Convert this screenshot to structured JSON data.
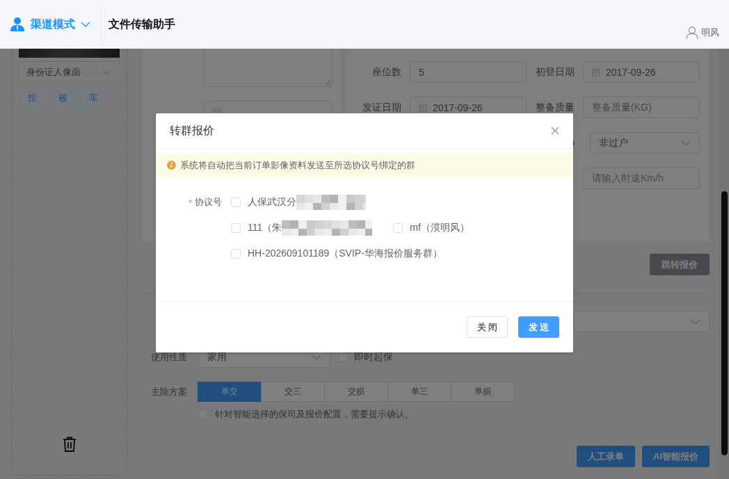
{
  "header": {
    "mode": "渠道模式",
    "title": "文件传输助手",
    "user": "明风"
  },
  "sidebar": {
    "document_type": "身份证人像面",
    "tags": [
      "投",
      "被",
      "车"
    ]
  },
  "vehicle_card": {
    "rows": [
      [
        {
          "label": "座位数",
          "value": "5",
          "kind": "text"
        },
        {
          "label": "初登日期",
          "value": "2017-09-26",
          "kind": "date"
        }
      ],
      [
        {
          "label": "发证日期",
          "value": "2017-09-26",
          "kind": "date"
        },
        {
          "label": "整备质量",
          "placeholder": "整备质量(KG)",
          "kind": "text"
        }
      ],
      [
        {
          "value": "非过户",
          "kind": "select",
          "hint": true
        }
      ],
      [
        {
          "placeholder": "请输入时速Km/h",
          "kind": "text"
        }
      ]
    ]
  },
  "jump_button": "跳转报价",
  "insurance": {
    "usage": {
      "label": "使用性质",
      "value": "家用"
    },
    "instant_start": {
      "label": "即时起保",
      "checked": false
    },
    "plan": {
      "label": "主险方案",
      "options": [
        {
          "label": "单交",
          "selected": true
        },
        {
          "label": "交三",
          "selected": false
        },
        {
          "label": "交损",
          "selected": false
        },
        {
          "label": "单三",
          "selected": false
        },
        {
          "label": "单损",
          "selected": false
        }
      ]
    },
    "confirm": {
      "label": "针对智能选择的保司及报价配置，需要提示确认。",
      "checked": false
    }
  },
  "actions": [
    "人工录单",
    "AI智能报价"
  ],
  "dialog": {
    "title": "转群报价",
    "notice": "系统将自动把当前订单影像资料发送至所选协议号绑定的群",
    "field": {
      "label": "协议号",
      "required_mark": "*"
    },
    "option_rows": [
      [
        {
          "label": "人保武汉分",
          "checked": false,
          "redacted": true
        }
      ],
      [
        {
          "label": "111（朱",
          "checked": false,
          "redacted": true
        },
        {
          "label": "mf（漠明风）",
          "checked": false,
          "redacted": false
        }
      ],
      [
        {
          "label": "HH-202609101189（SVIP-华海报价服务群）",
          "checked": false,
          "redacted": false
        }
      ]
    ],
    "buttons": [
      {
        "label": "关 闭",
        "kind": "default"
      },
      {
        "label": "发 送",
        "kind": "primary"
      }
    ]
  }
}
